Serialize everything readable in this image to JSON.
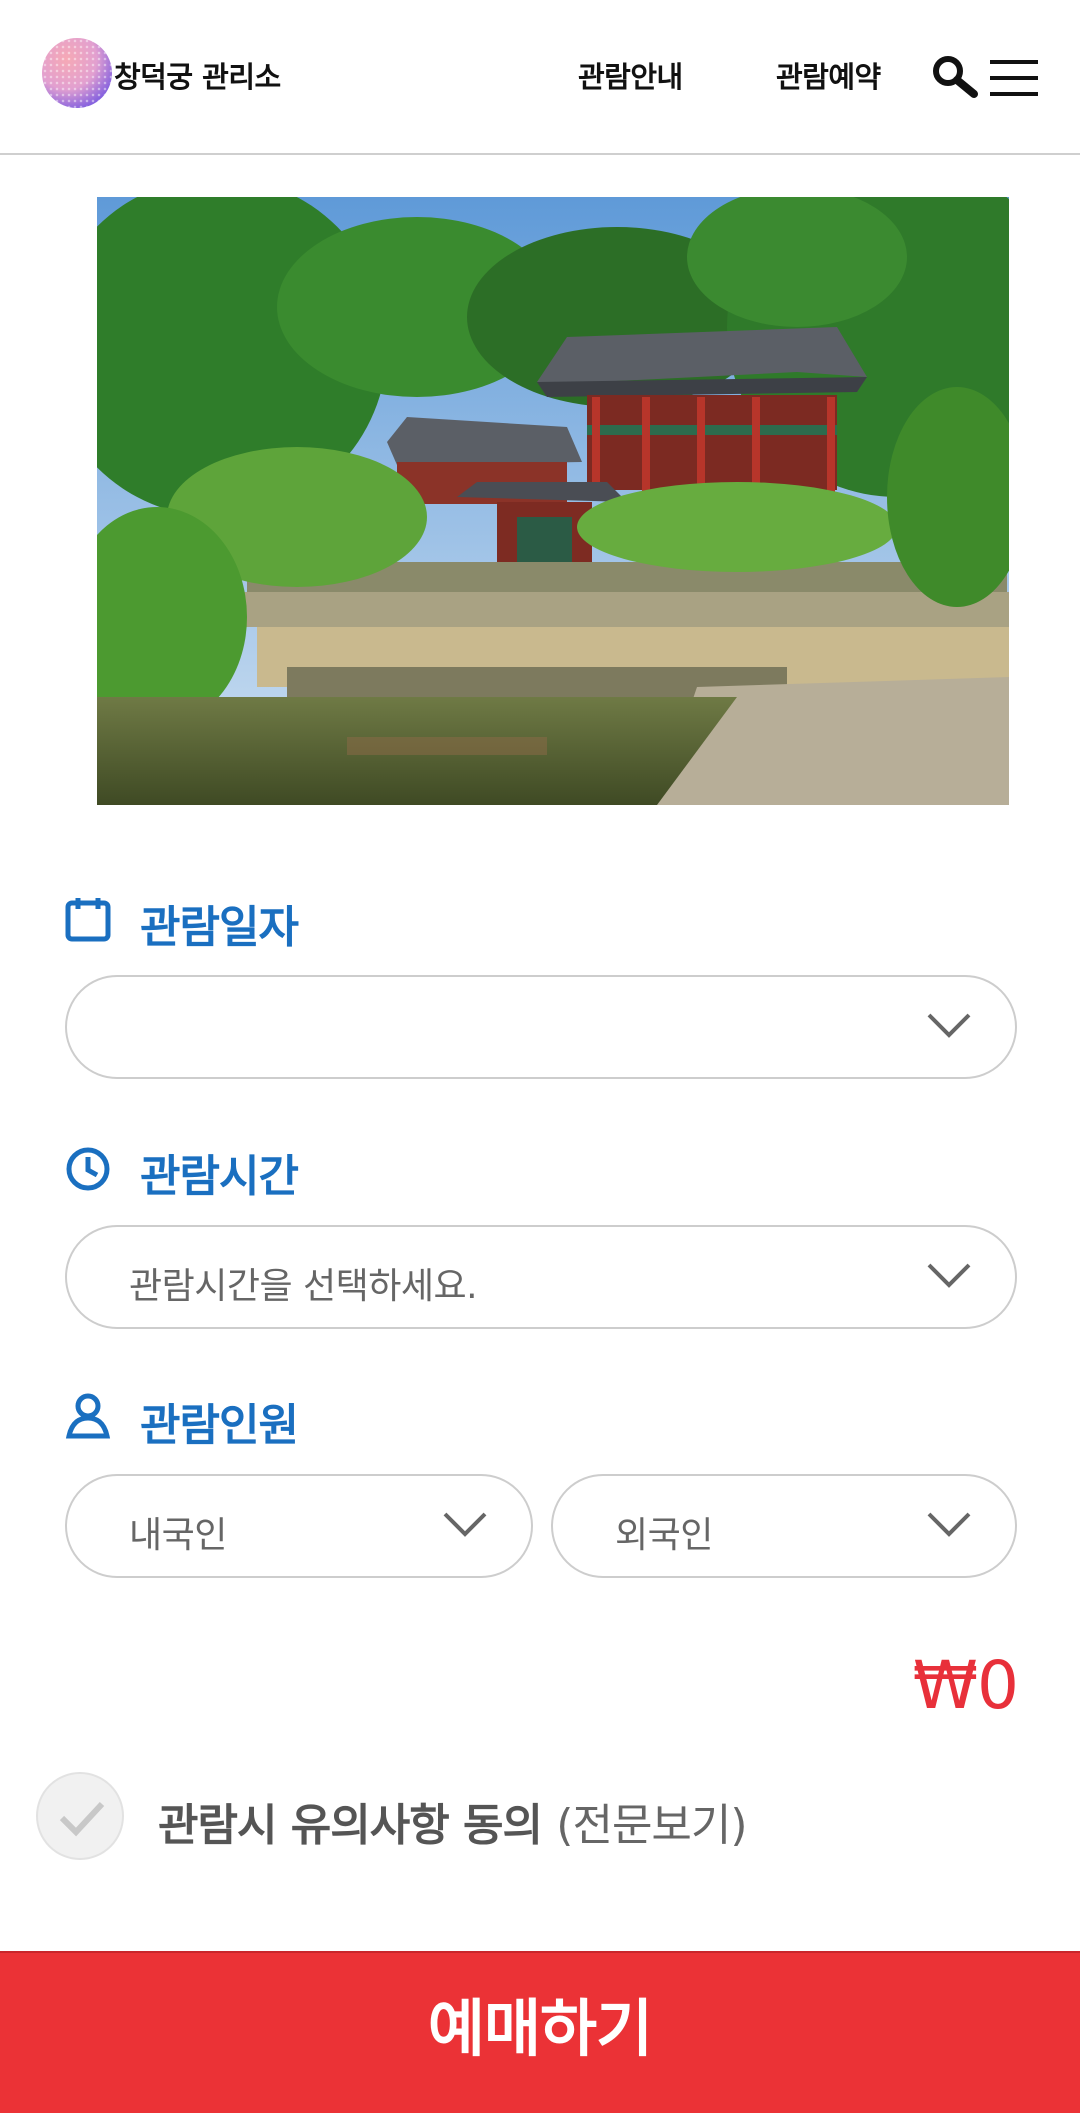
{
  "header": {
    "brand": "창덕궁 관리소",
    "nav": [
      "관람안내",
      "관람예약"
    ],
    "icons": [
      "search-icon",
      "hamburger-menu-icon"
    ]
  },
  "hero": {
    "description_icon": "palace-photo"
  },
  "form": {
    "date": {
      "label": "관람일자",
      "value": "",
      "icon": "calendar-icon"
    },
    "time": {
      "label": "관람시간",
      "placeholder": "관람시간을 선택하세요.",
      "icon": "clock-icon"
    },
    "people": {
      "label": "관람인원",
      "icon": "person-icon",
      "domestic_placeholder": "내국인",
      "foreign_placeholder": "외국인"
    }
  },
  "total_price": "₩0",
  "agreement": {
    "label": "관람시 유의사항 동의",
    "link": "(전문보기)"
  },
  "cta": {
    "label": "예매하기"
  },
  "colors": {
    "accent_blue": "#1a6fc0",
    "cta_red": "#eb3236",
    "price_red": "#e8303a"
  }
}
